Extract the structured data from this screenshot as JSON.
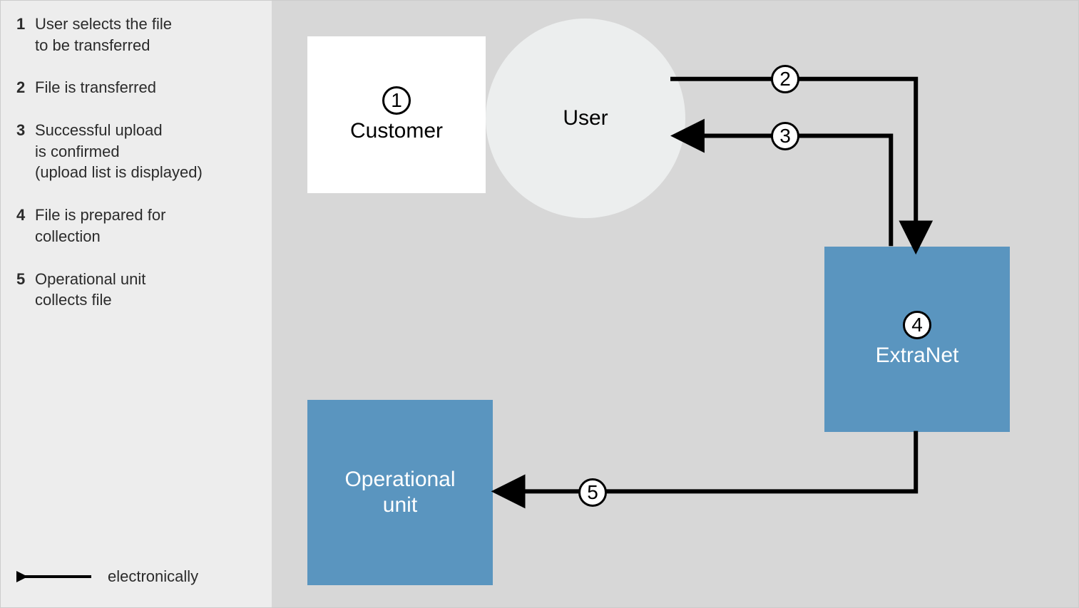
{
  "legend": {
    "items": [
      {
        "num": "1",
        "lines": [
          "User selects the file",
          "to be transferred"
        ]
      },
      {
        "num": "2",
        "lines": [
          "File is transferred"
        ]
      },
      {
        "num": "3",
        "lines": [
          "Successful upload",
          "is confirmed",
          "(upload list is displayed)"
        ]
      },
      {
        "num": "4",
        "lines": [
          "File is prepared for",
          "collection"
        ]
      },
      {
        "num": "5",
        "lines": [
          "Operational unit",
          "collects file"
        ]
      }
    ],
    "footer": "electronically"
  },
  "nodes": {
    "customer": {
      "badge": "1",
      "label": "Customer"
    },
    "user": {
      "label": "User"
    },
    "extranet": {
      "badge": "4",
      "label": "ExtraNet"
    },
    "operational": {
      "lines": [
        "Operational",
        "unit"
      ]
    }
  },
  "arrowBadges": {
    "a2": "2",
    "a3": "3",
    "a5": "5"
  }
}
